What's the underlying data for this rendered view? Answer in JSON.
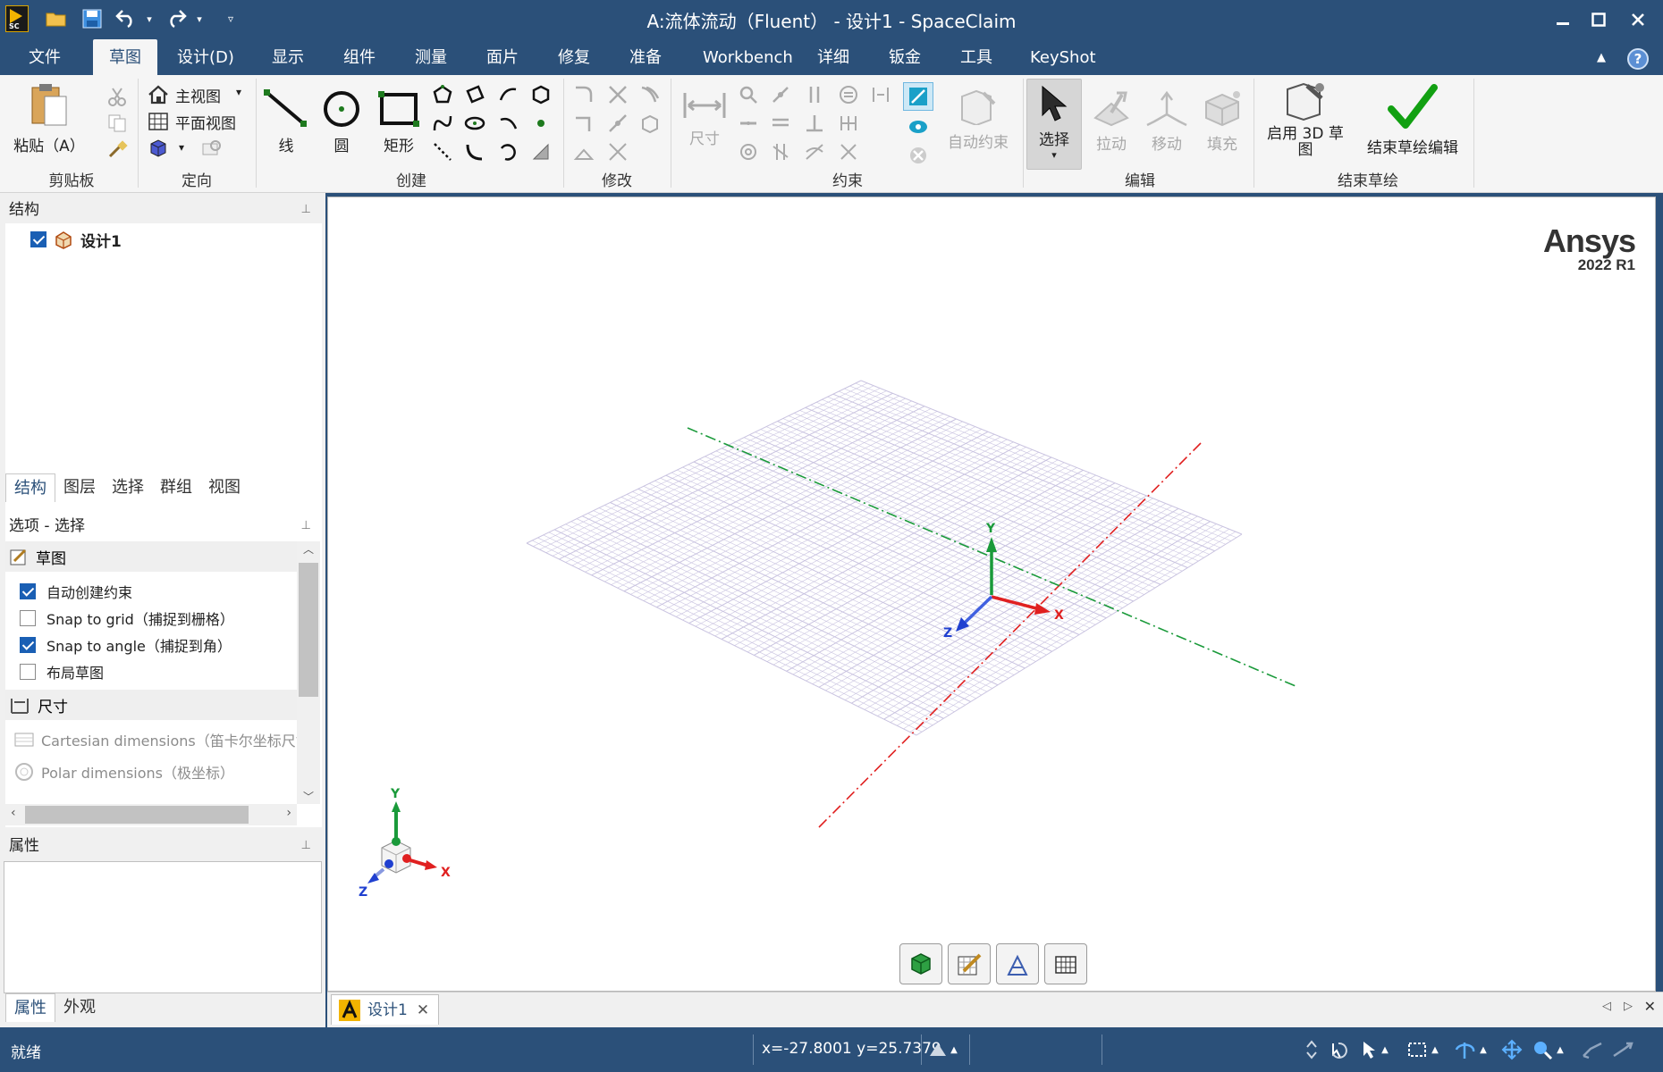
{
  "window": {
    "title": "A:流体流动（Fluent） - 设计1 - SpaceClaim",
    "app_icon_text": "SC"
  },
  "menu": {
    "items": [
      "文件",
      "草图",
      "设计(D)",
      "显示",
      "组件",
      "测量",
      "面片",
      "修复",
      "准备",
      "Workbench",
      "详细",
      "钣金",
      "工具",
      "KeyShot"
    ],
    "active": "草图"
  },
  "ribbon": {
    "clipboard": {
      "paste_label": "粘贴（A）",
      "group_label": "剪贴板"
    },
    "orient": {
      "home_view": "主视图",
      "plan_view": "平面视图",
      "group_label": "定向"
    },
    "create": {
      "line": "线",
      "circle": "圆",
      "rect": "矩形",
      "group_label": "创建"
    },
    "modify": {
      "group_label": "修改"
    },
    "constrain": {
      "dimension": "尺寸",
      "auto_constrain": "自动约束",
      "group_label": "约束"
    },
    "edit": {
      "select": "选择",
      "pull": "拉动",
      "move": "移动",
      "fill": "填充",
      "group_label": "编辑"
    },
    "end": {
      "enable_3d_line1": "启用 3D 草",
      "enable_3d_line2": "图",
      "finish": "结束草绘编辑",
      "group_label": "结束草绘"
    }
  },
  "structure_panel": {
    "title": "结构",
    "tree": [
      {
        "label": "设计1",
        "checked": true
      }
    ],
    "tabs": [
      "结构",
      "图层",
      "选择",
      "群组",
      "视图"
    ],
    "active_tab": "结构"
  },
  "options_panel": {
    "title": "选项 - 选择",
    "sketch_section": "草图",
    "options": [
      {
        "label": "自动创建约束",
        "checked": true
      },
      {
        "label": "Snap to grid（捕捉到栅格）",
        "checked": false
      },
      {
        "label": "Snap to angle（捕捉到角）",
        "checked": true
      },
      {
        "label": "布局草图",
        "checked": false
      }
    ],
    "dim_section": "尺寸",
    "dim_options": [
      {
        "label": "Cartesian dimensions（笛卡尔坐标尺寸"
      },
      {
        "label": "Polar dimensions（极坐标）"
      }
    ]
  },
  "properties_panel": {
    "title": "属性",
    "tabs": [
      "属性",
      "外观"
    ],
    "active_tab": "属性"
  },
  "viewport": {
    "brand": "Ansys",
    "version": "2022 R1",
    "axis_labels": {
      "x": "X",
      "y": "Y",
      "z": "Z"
    },
    "colors": {
      "x_axis": "#e02020",
      "y_axis": "#1a9a3a",
      "z_axis": "#2040d0",
      "grid": "#c9c3e0"
    }
  },
  "document_tabs": [
    {
      "label": "设计1"
    }
  ],
  "status": {
    "ready": "就绪",
    "coords": "x=-27.8001  y=25.7379"
  }
}
